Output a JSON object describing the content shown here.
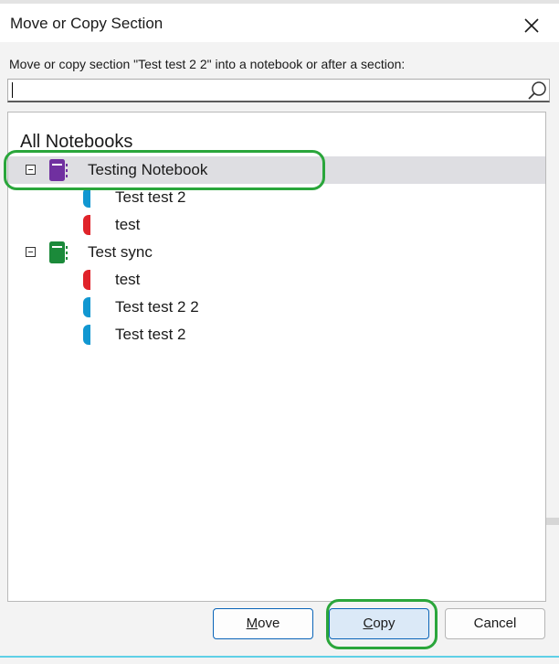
{
  "dialog": {
    "title": "Move or Copy Section",
    "close_icon": "close-icon",
    "prompt": "Move or copy section \"Test test 2 2\" into a notebook or after a section:",
    "search": {
      "value": "",
      "placeholder": "",
      "icon": "search-icon"
    }
  },
  "tree": {
    "header": "All Notebooks",
    "notebooks": [
      {
        "label": "Testing Notebook",
        "color": "#7030a0",
        "expanded": true,
        "selected": true,
        "sections": [
          {
            "label": "Test test 2",
            "color": "#1197d1"
          },
          {
            "label": "test",
            "color": "#e0232a"
          }
        ]
      },
      {
        "label": "Test sync",
        "color": "#1b8a3a",
        "expanded": true,
        "selected": false,
        "sections": [
          {
            "label": "test",
            "color": "#e0232a"
          },
          {
            "label": "Test test 2 2",
            "color": "#1197d1"
          },
          {
            "label": "Test test 2",
            "color": "#1197d1"
          }
        ]
      }
    ]
  },
  "buttons": {
    "move_mnemonic": "M",
    "move_rest": "ove",
    "copy_mnemonic": "C",
    "copy_rest": "opy",
    "cancel": "Cancel"
  },
  "highlight_color": "#2aa63b"
}
